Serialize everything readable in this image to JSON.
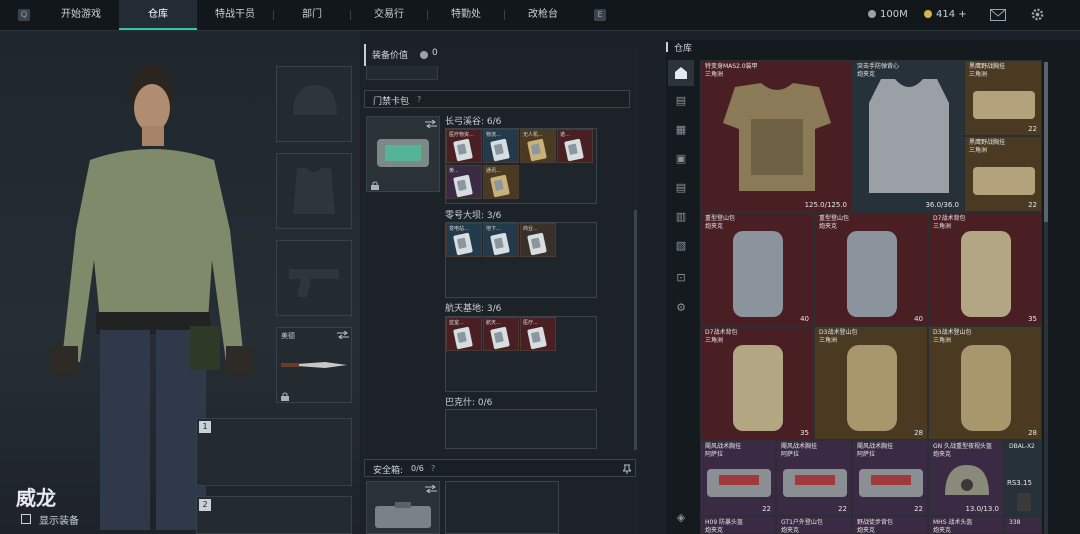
{
  "topbar": {
    "key_left": "Q",
    "key_right": "E",
    "tabs": [
      {
        "label": "开始游戏",
        "active": false
      },
      {
        "label": "仓库",
        "active": true
      },
      {
        "label": "特战干员",
        "active": false
      },
      {
        "label": "部门",
        "active": false
      },
      {
        "label": "交易行",
        "active": false
      },
      {
        "label": "特勤处",
        "active": false
      },
      {
        "label": "改枪台",
        "active": false
      }
    ],
    "currency_1": "100M",
    "currency_2": "414 +"
  },
  "character": {
    "name": "威龙",
    "show_gear_label": "显示装备",
    "knife_label": "美德",
    "slot_1_num": "1",
    "slot_2_num": "2"
  },
  "middle": {
    "equip_value_label": "装备价值",
    "equip_value": "0",
    "keycard_header": "门禁卡包",
    "help": "?",
    "sections": [
      {
        "title": "长弓溪谷: 6/6"
      },
      {
        "title": "零号大坝: 3/6"
      },
      {
        "title": "航天基地: 3/6"
      },
      {
        "title": "巴克什: 0/6"
      }
    ],
    "cards_cgxg": [
      "医疗物资...",
      "物流...",
      "无人机...",
      "诺...",
      "黄...",
      "通讯..."
    ],
    "cards_lhdb": [
      "变电站...",
      "地下...",
      "商业..."
    ],
    "cards_htjd": [
      "蓝室...",
      "航天...",
      "医疗..."
    ],
    "safe_box_label": "安全箱:",
    "safe_box_count": "0/6"
  },
  "warehouse": {
    "title": "仓库",
    "items": [
      {
        "name": "特变身MAS2.0装甲\n三角洲",
        "badge": "125.0/125.0"
      },
      {
        "name": "突击手防弹背心\n炮夹克",
        "badge": "36.0/36.0"
      },
      {
        "name": "黑鹰野战胸挂\n三角洲",
        "badge": "22"
      },
      {
        "name": "黑鹰野战胸挂\n三角洲",
        "badge": "22"
      },
      {
        "name": "重型登山包\n炮夹克",
        "badge": "40"
      },
      {
        "name": "重型登山包\n炮夹克",
        "badge": "40"
      },
      {
        "name": "D7战术背包\n三角洲",
        "badge": "35"
      },
      {
        "name": "D7战术背包\n三角洲",
        "badge": "35"
      },
      {
        "name": "D3战术登山包\n三角洲",
        "badge": "28"
      },
      {
        "name": "D3战术登山包\n三角洲",
        "badge": "28"
      },
      {
        "name": "飓风战术胸挂\n阿萨拉",
        "badge": "22"
      },
      {
        "name": "飓风战术胸挂\n阿萨拉",
        "badge": "22"
      },
      {
        "name": "飓风战术胸挂\n阿萨拉",
        "badge": "22"
      },
      {
        "name": "GN 久战重型夜视头盔\n炮夹克",
        "badge": "13.0/13.0"
      },
      {
        "name": "DBAL-X2",
        "badge": "RS3.15"
      },
      {
        "name": "H09 防暴头盔\n炮夹克",
        "badge": ""
      },
      {
        "name": "GT1户外登山包\n炮夹克",
        "badge": ""
      },
      {
        "name": "野战徒步背包\n炮夹克",
        "badge": ""
      },
      {
        "name": "MHS 战术头盔\n炮夹克",
        "badge": ""
      },
      {
        "name": "338",
        "badge": ""
      }
    ]
  },
  "colors": {
    "accent": "#2fc6a0",
    "rare_red": "#4a1f24",
    "gold": "#4a3a22",
    "purple": "#3a2a44"
  }
}
